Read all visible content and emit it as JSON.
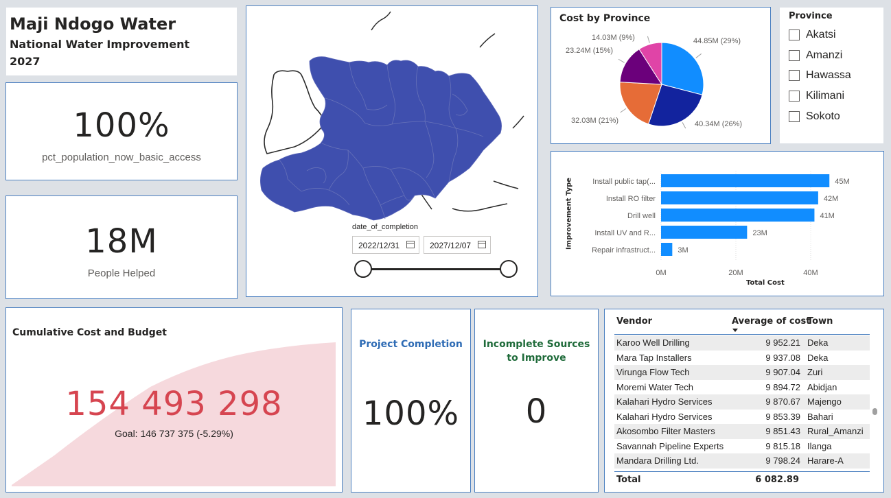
{
  "title": {
    "main": "Maji Ndogo Water",
    "line1": "National Water Improvement",
    "line2": "2027"
  },
  "kpi_access": {
    "value": "100%",
    "label": "pct_population_now_basic_access"
  },
  "kpi_people": {
    "value": "18M",
    "label": "People Helped"
  },
  "map": {
    "date_label": "date_of_completion",
    "start_date": "2022/12/31",
    "end_date": "2027/12/07",
    "fill_color": "#3f4fae"
  },
  "pie": {
    "title": "Cost by Province",
    "labels": [
      "44.85M (29%)",
      "40.34M (26%)",
      "32.03M (21%)",
      "23.24M (15%)",
      "14.03M (9%)"
    ]
  },
  "province_slicer": {
    "title": "Province",
    "items": [
      "Akatsi",
      "Amanzi",
      "Hawassa",
      "Kilimani",
      "Sokoto"
    ]
  },
  "bar": {
    "ylabel": "Improvement Type",
    "xlabel": "Total Cost",
    "data_labels": [
      "45M",
      "42M",
      "41M",
      "23M",
      "3M"
    ],
    "ticks": [
      "0M",
      "20M",
      "40M"
    ]
  },
  "cumulative": {
    "title": "Cumulative Cost and Budget",
    "value": "154 493 298",
    "goal": "Goal: 146 737 375 (-5.29%)",
    "alert": "!"
  },
  "project_completion": {
    "title": "Project Completion",
    "value": "100%"
  },
  "incomplete": {
    "title_line1": "Incomplete Sources",
    "title_line2": "to Improve",
    "value": "0"
  },
  "table": {
    "headers": {
      "vendor": "Vendor",
      "avg": "Average of cost",
      "town": "Town"
    },
    "rows": [
      {
        "vendor": "Karoo Well Drilling",
        "avg": "9 952.21",
        "town": "Deka"
      },
      {
        "vendor": "Mara Tap Installers",
        "avg": "9 937.08",
        "town": "Deka"
      },
      {
        "vendor": "Virunga Flow Tech",
        "avg": "9 907.04",
        "town": "Zuri"
      },
      {
        "vendor": "Moremi Water Tech",
        "avg": "9 894.72",
        "town": "Abidjan"
      },
      {
        "vendor": "Kalahari Hydro Services",
        "avg": "9 870.67",
        "town": "Majengo"
      },
      {
        "vendor": "Kalahari Hydro Services",
        "avg": "9 853.39",
        "town": "Bahari"
      },
      {
        "vendor": "Akosombo Filter Masters",
        "avg": "9 851.43",
        "town": "Rural_Amanzi"
      },
      {
        "vendor": "Savannah Pipeline Experts",
        "avg": "9 815.18",
        "town": "Ilanga"
      },
      {
        "vendor": "Mandara Drilling Ltd.",
        "avg": "9 798.24",
        "town": "Harare-A"
      }
    ],
    "total_label": "Total",
    "total_value": "6 082.89"
  },
  "chart_data": [
    {
      "type": "pie",
      "title": "Cost by Province",
      "values": [
        44.85,
        40.34,
        32.03,
        23.24,
        14.03
      ],
      "percents": [
        29,
        26,
        21,
        15,
        9
      ],
      "colors": [
        "#118dff",
        "#12239e",
        "#e66c37",
        "#6b007b",
        "#e044a7"
      ]
    },
    {
      "type": "bar",
      "orientation": "horizontal",
      "categories": [
        "Install public tap(...",
        "Install RO filter",
        "Drill well",
        "Install UV and R...",
        "Repair infrastruct..."
      ],
      "values": [
        45,
        42,
        41,
        23,
        3
      ],
      "xlabel": "Total Cost",
      "ylabel": "Improvement Type",
      "xlim": [
        0,
        50
      ],
      "color": "#118dff"
    }
  ]
}
